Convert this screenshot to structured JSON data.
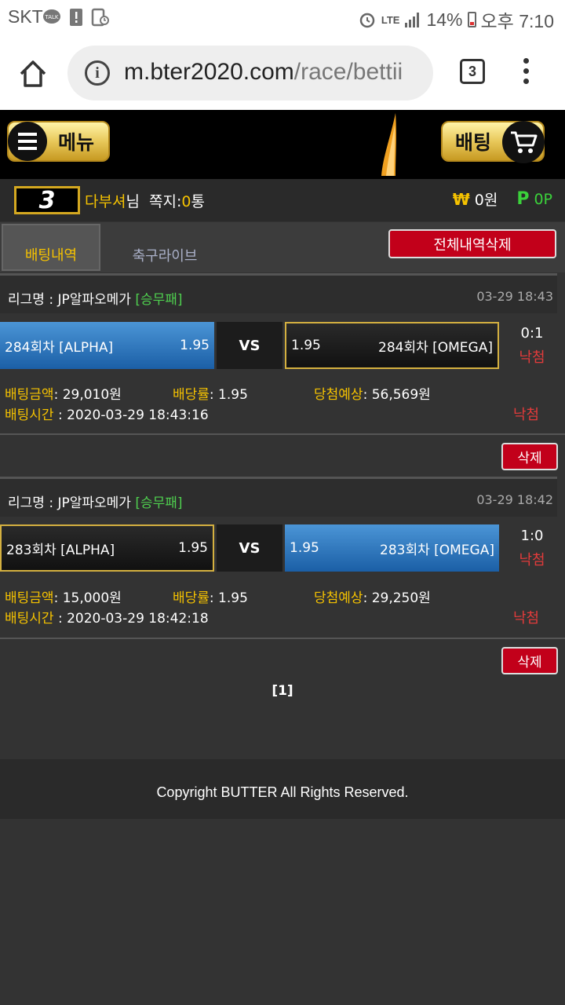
{
  "status_bar": {
    "carrier": "SKT",
    "network": "LTE",
    "battery": "14%",
    "time": "오후 7:10"
  },
  "browser": {
    "url_host": "m.bter2020.com",
    "url_path": "/race/bettii",
    "tab_count": "3"
  },
  "header": {
    "menu_label": "메뉴",
    "bet_label": "배팅"
  },
  "user": {
    "level": "3",
    "nickname": "다부셔",
    "honorific": "님",
    "msg_label": "쪽지:",
    "msg_count": "0",
    "msg_unit": "통",
    "money_symbol": "₩",
    "money": "0원",
    "point_symbol": "P",
    "points": "0P"
  },
  "tabs": {
    "betting_history": "배팅내역",
    "football_live": "축구라이브",
    "delete_all": "전체내역삭제"
  },
  "bets": [
    {
      "league_label": "리그명 : JP알파오메가",
      "bet_type": "[승무패]",
      "datetime": "03-29 18:43",
      "home_team": "284회차 [ALPHA]",
      "home_odds": "1.95",
      "vs": "VS",
      "away_odds": "1.95",
      "away_team": "284회차 [OMEGA]",
      "score": "0:1",
      "result": "낙첨",
      "amount_label": "배팅금액",
      "amount": ": 29,010원",
      "rate_label": "배당률",
      "rate": ": 1.95",
      "expected_label": "당첨예상",
      "expected": ": 56,569원",
      "time_label": "배팅시간",
      "time": " : 2020-03-29 18:43:16",
      "result2": "낙첨",
      "delete_label": "삭제"
    },
    {
      "league_label": "리그명 : JP알파오메가",
      "bet_type": "[승무패]",
      "datetime": "03-29 18:42",
      "home_team": "283회차 [ALPHA]",
      "home_odds": "1.95",
      "vs": "VS",
      "away_odds": "1.95",
      "away_team": "283회차 [OMEGA]",
      "score": "1:0",
      "result": "낙첨",
      "amount_label": "배팅금액",
      "amount": ": 15,000원",
      "rate_label": "배당률",
      "rate": ": 1.95",
      "expected_label": "당첨예상",
      "expected": ": 29,250원",
      "time_label": "배팅시간",
      "time": " : 2020-03-29 18:42:18",
      "result2": "낙첨",
      "delete_label": "삭제"
    }
  ],
  "pagination": "[1]",
  "footer": "Copyright BUTTER All Rights Reserved.",
  "colors": {
    "gold": "#f5c200",
    "red": "#c2001a",
    "green": "#4fd04f",
    "blue": "#1b5fa6"
  }
}
